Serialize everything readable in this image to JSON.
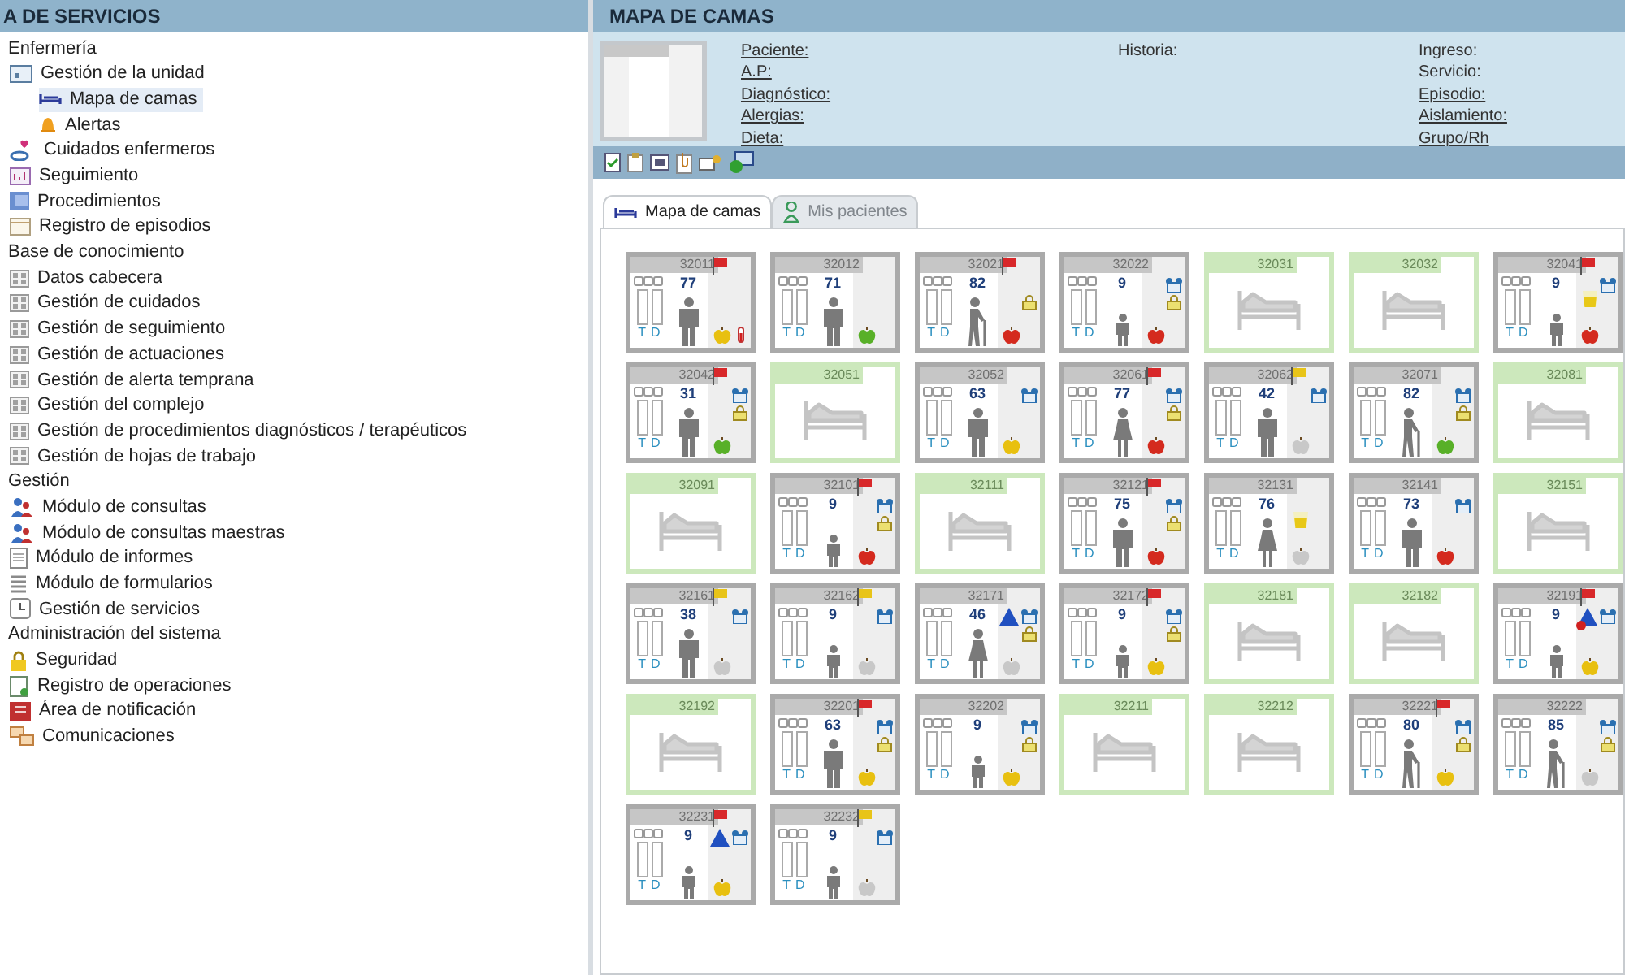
{
  "sidebar": {
    "title": "A DE SERVICIOS",
    "groups": [
      {
        "label": "Enfermería",
        "children": [
          {
            "label": "Gestión de la unidad",
            "kind": "unit",
            "selected": false,
            "children": [
              {
                "label": "Mapa de camas",
                "kind": "bed",
                "selected": true
              },
              {
                "label": "Alertas",
                "kind": "bell",
                "selected": false
              }
            ]
          },
          {
            "label": "Cuidados enfermeros",
            "kind": "care",
            "selected": false
          },
          {
            "label": "Seguimiento",
            "kind": "chart",
            "selected": false
          },
          {
            "label": "Procedimientos",
            "kind": "proc",
            "selected": false
          },
          {
            "label": "Registro de episodios",
            "kind": "register",
            "selected": false
          }
        ]
      },
      {
        "label": "Base de conocimiento",
        "children": [
          {
            "label": "Datos cabecera",
            "kind": "grid",
            "selected": false
          },
          {
            "label": "Gestión de cuidados",
            "kind": "grid",
            "selected": false
          },
          {
            "label": "Gestión de seguimiento",
            "kind": "grid",
            "selected": false
          },
          {
            "label": "Gestión de actuaciones",
            "kind": "grid",
            "selected": false
          },
          {
            "label": "Gestión de alerta temprana",
            "kind": "grid",
            "selected": false
          },
          {
            "label": "Gestión del complejo",
            "kind": "grid",
            "selected": false
          },
          {
            "label": "Gestión de procedimientos diagnósticos / terapéuticos",
            "kind": "grid",
            "selected": false
          },
          {
            "label": "Gestión de hojas de trabajo",
            "kind": "grid",
            "selected": false
          }
        ]
      },
      {
        "label": "Gestión",
        "children": [
          {
            "label": "Módulo de consultas",
            "kind": "consult",
            "selected": false
          },
          {
            "label": "Módulo de consultas maestras",
            "kind": "consult",
            "selected": false
          },
          {
            "label": "Módulo de informes",
            "kind": "report",
            "selected": false
          },
          {
            "label": "Módulo de formularios",
            "kind": "form",
            "selected": false
          },
          {
            "label": "Gestión de servicios",
            "kind": "service",
            "selected": false
          }
        ]
      },
      {
        "label": "Administración del sistema",
        "children": [
          {
            "label": "Seguridad",
            "kind": "lock",
            "selected": false
          },
          {
            "label": "Registro de operaciones",
            "kind": "ops",
            "selected": false
          },
          {
            "label": "Área de notificación",
            "kind": "notify",
            "selected": false
          },
          {
            "label": "Comunicaciones",
            "kind": "comms",
            "selected": false
          }
        ]
      }
    ]
  },
  "main": {
    "title": "MAPA DE CAMAS",
    "patient_fields": [
      [
        {
          "label": "Paciente:",
          "link": true
        },
        {
          "label": "A.P:",
          "link": true
        },
        {
          "label": "Diagnóstico:",
          "link": true
        },
        {
          "label": "Alergias:",
          "link": true
        },
        {
          "label": "Dieta:",
          "link": true
        }
      ],
      [
        {
          "label": "Historia:",
          "link": false
        }
      ],
      [
        {
          "label": "Ingreso:",
          "link": false
        },
        {
          "label": "Servicio:",
          "link": false
        },
        {
          "label": "Episodio:",
          "link": true
        },
        {
          "label": "Aislamiento:",
          "link": true
        },
        {
          "label": "Grupo/Rh",
          "link": true
        }
      ]
    ],
    "tabs": [
      {
        "label": "Mapa de camas",
        "selected": true,
        "disabled": false
      },
      {
        "label": "Mis pacientes",
        "selected": false,
        "disabled": true
      }
    ],
    "beds": [
      {
        "number": "32011",
        "kind": "occupied",
        "age": "77",
        "patient": {
          "kind": "man"
        },
        "flag": {
          "color": "#d8282a"
        },
        "diet": {
          "color": "#e8c010"
        },
        "thermometer": true,
        "t": "T",
        "d": "D"
      },
      {
        "number": "32012",
        "kind": "occupied",
        "age": "71",
        "patient": {
          "kind": "man"
        },
        "diet": {
          "color": "#58b028"
        },
        "t": "T",
        "d": "D"
      },
      {
        "number": "32021",
        "kind": "occupied",
        "age": "82",
        "patient": {
          "kind": "elder"
        },
        "flag": {
          "color": "#d8282a"
        },
        "lock": true,
        "diet": {
          "color": "#d42a1e"
        },
        "t": "T",
        "d": "D"
      },
      {
        "number": "32022",
        "kind": "occupied",
        "age": "9",
        "patient": {
          "kind": "child"
        },
        "alarm": true,
        "lock": true,
        "diet": {
          "color": "#d42a1e"
        },
        "t": "T",
        "d": "D"
      },
      {
        "number": "32031",
        "kind": "empty"
      },
      {
        "number": "32032",
        "kind": "empty"
      },
      {
        "number": "32041",
        "kind": "occupied",
        "age": "9",
        "patient": {
          "kind": "child"
        },
        "flag": {
          "color": "#d8282a"
        },
        "alarm": true,
        "cup": true,
        "diet": {
          "color": "#d42a1e"
        },
        "t": "T",
        "d": "D"
      },
      {
        "number": "32042",
        "kind": "occupied",
        "age": "31",
        "patient": {
          "kind": "man"
        },
        "flag": {
          "color": "#d8282a"
        },
        "alarm": true,
        "lock": true,
        "diet": {
          "color": "#58b028"
        },
        "t": "T",
        "d": "D"
      },
      {
        "number": "32051",
        "kind": "empty"
      },
      {
        "number": "32052",
        "kind": "occupied",
        "age": "63",
        "patient": {
          "kind": "man"
        },
        "alarm": true,
        "diet": {
          "color": "#e8c010"
        },
        "t": "T",
        "d": "D"
      },
      {
        "number": "32061",
        "kind": "occupied",
        "age": "77",
        "patient": {
          "kind": "woman"
        },
        "flag": {
          "color": "#d8282a"
        },
        "alarm": true,
        "lock": true,
        "diet": {
          "color": "#d42a1e"
        },
        "t": "T",
        "d": "D"
      },
      {
        "number": "32062",
        "kind": "occupied",
        "age": "42",
        "patient": {
          "kind": "man"
        },
        "flag": {
          "color": "#e8c418"
        },
        "alarm": true,
        "diet": {
          "color": "#c8c8c8"
        },
        "t": "T",
        "d": "D"
      },
      {
        "number": "32071",
        "kind": "occupied",
        "age": "82",
        "patient": {
          "kind": "elder"
        },
        "alarm": true,
        "lock": true,
        "diet": {
          "color": "#58b028"
        },
        "t": "T",
        "d": "D"
      },
      {
        "number": "32081",
        "kind": "empty"
      },
      {
        "number": "32091",
        "kind": "empty"
      },
      {
        "number": "32101",
        "kind": "occupied",
        "age": "9",
        "patient": {
          "kind": "child"
        },
        "flag": {
          "color": "#d8282a"
        },
        "alarm": true,
        "lock": true,
        "diet": {
          "color": "#d42a1e"
        },
        "t": "T",
        "d": "D"
      },
      {
        "number": "32111",
        "kind": "empty"
      },
      {
        "number": "32121",
        "kind": "occupied",
        "age": "75",
        "patient": {
          "kind": "man"
        },
        "flag": {
          "color": "#d8282a"
        },
        "alarm": true,
        "lock": true,
        "diet": {
          "color": "#d42a1e"
        },
        "t": "T",
        "d": "D"
      },
      {
        "number": "32131",
        "kind": "occupied",
        "age": "76",
        "patient": {
          "kind": "woman"
        },
        "cup": true,
        "diet": {
          "color": "#c8c8c8"
        },
        "t": "T",
        "d": "D"
      },
      {
        "number": "32141",
        "kind": "occupied",
        "age": "73",
        "patient": {
          "kind": "man"
        },
        "alarm": true,
        "diet": {
          "color": "#d42a1e"
        },
        "t": "T",
        "d": "D"
      },
      {
        "number": "32151",
        "kind": "empty"
      },
      {
        "number": "32161",
        "kind": "occupied",
        "age": "38",
        "patient": {
          "kind": "man"
        },
        "flag": {
          "color": "#e8c418"
        },
        "alarm": true,
        "diet": {
          "color": "#c8c8c8"
        },
        "t": "T",
        "d": "D"
      },
      {
        "number": "32162",
        "kind": "occupied",
        "age": "9",
        "patient": {
          "kind": "child"
        },
        "flag": {
          "color": "#e8c418"
        },
        "alarm": true,
        "diet": {
          "color": "#c8c8c8"
        },
        "t": "T",
        "d": "D"
      },
      {
        "number": "32171",
        "kind": "occupied",
        "age": "46",
        "patient": {
          "kind": "woman"
        },
        "triangle": true,
        "alarm": true,
        "lock": true,
        "diet": {
          "color": "#c8c8c8"
        },
        "t": "T",
        "d": "D"
      },
      {
        "number": "32172",
        "kind": "occupied",
        "age": "9",
        "patient": {
          "kind": "child"
        },
        "flag": {
          "color": "#d8282a"
        },
        "alarm": true,
        "lock": true,
        "diet": {
          "color": "#e8c010"
        },
        "t": "T",
        "d": "D"
      },
      {
        "number": "32181",
        "kind": "empty"
      },
      {
        "number": "32182",
        "kind": "empty"
      },
      {
        "number": "32191",
        "kind": "occupied",
        "age": "9",
        "patient": {
          "kind": "child"
        },
        "flag": {
          "color": "#d8282a"
        },
        "triangle": true,
        "dot": true,
        "alarm": true,
        "diet": {
          "color": "#e8c010"
        },
        "t": "T",
        "d": "D"
      },
      {
        "number": "32192",
        "kind": "empty"
      },
      {
        "number": "32201",
        "kind": "occupied",
        "age": "63",
        "patient": {
          "kind": "man"
        },
        "flag": {
          "color": "#d8282a"
        },
        "alarm": true,
        "lock": true,
        "diet": {
          "color": "#e8c010"
        },
        "t": "T",
        "d": "D"
      },
      {
        "number": "32202",
        "kind": "occupied",
        "age": "9",
        "patient": {
          "kind": "child"
        },
        "alarm": true,
        "lock": true,
        "diet": {
          "color": "#e8c010"
        },
        "t": "T",
        "d": "D"
      },
      {
        "number": "32211",
        "kind": "empty"
      },
      {
        "number": "32212",
        "kind": "empty"
      },
      {
        "number": "32221",
        "kind": "occupied",
        "age": "80",
        "patient": {
          "kind": "elder"
        },
        "flag": {
          "color": "#d8282a"
        },
        "alarm": true,
        "lock": true,
        "diet": {
          "color": "#e8c010"
        },
        "t": "T",
        "d": "D"
      },
      {
        "number": "32222",
        "kind": "occupied",
        "age": "85",
        "patient": {
          "kind": "elder"
        },
        "alarm": true,
        "lock": true,
        "diet": {
          "color": "#c8c8c8"
        },
        "t": "T",
        "d": "D"
      },
      {
        "number": "32231",
        "kind": "occupied",
        "age": "9",
        "patient": {
          "kind": "child"
        },
        "flag": {
          "color": "#d8282a"
        },
        "triangle": true,
        "alarm": true,
        "diet": {
          "color": "#e8c010"
        },
        "t": "T",
        "d": "D"
      },
      {
        "number": "32232",
        "kind": "occupied",
        "age": "9",
        "patient": {
          "kind": "child"
        },
        "flag": {
          "color": "#e8c418"
        },
        "alarm": true,
        "diet": {
          "color": "#c8c8c8"
        },
        "t": "T",
        "d": "D"
      }
    ]
  }
}
